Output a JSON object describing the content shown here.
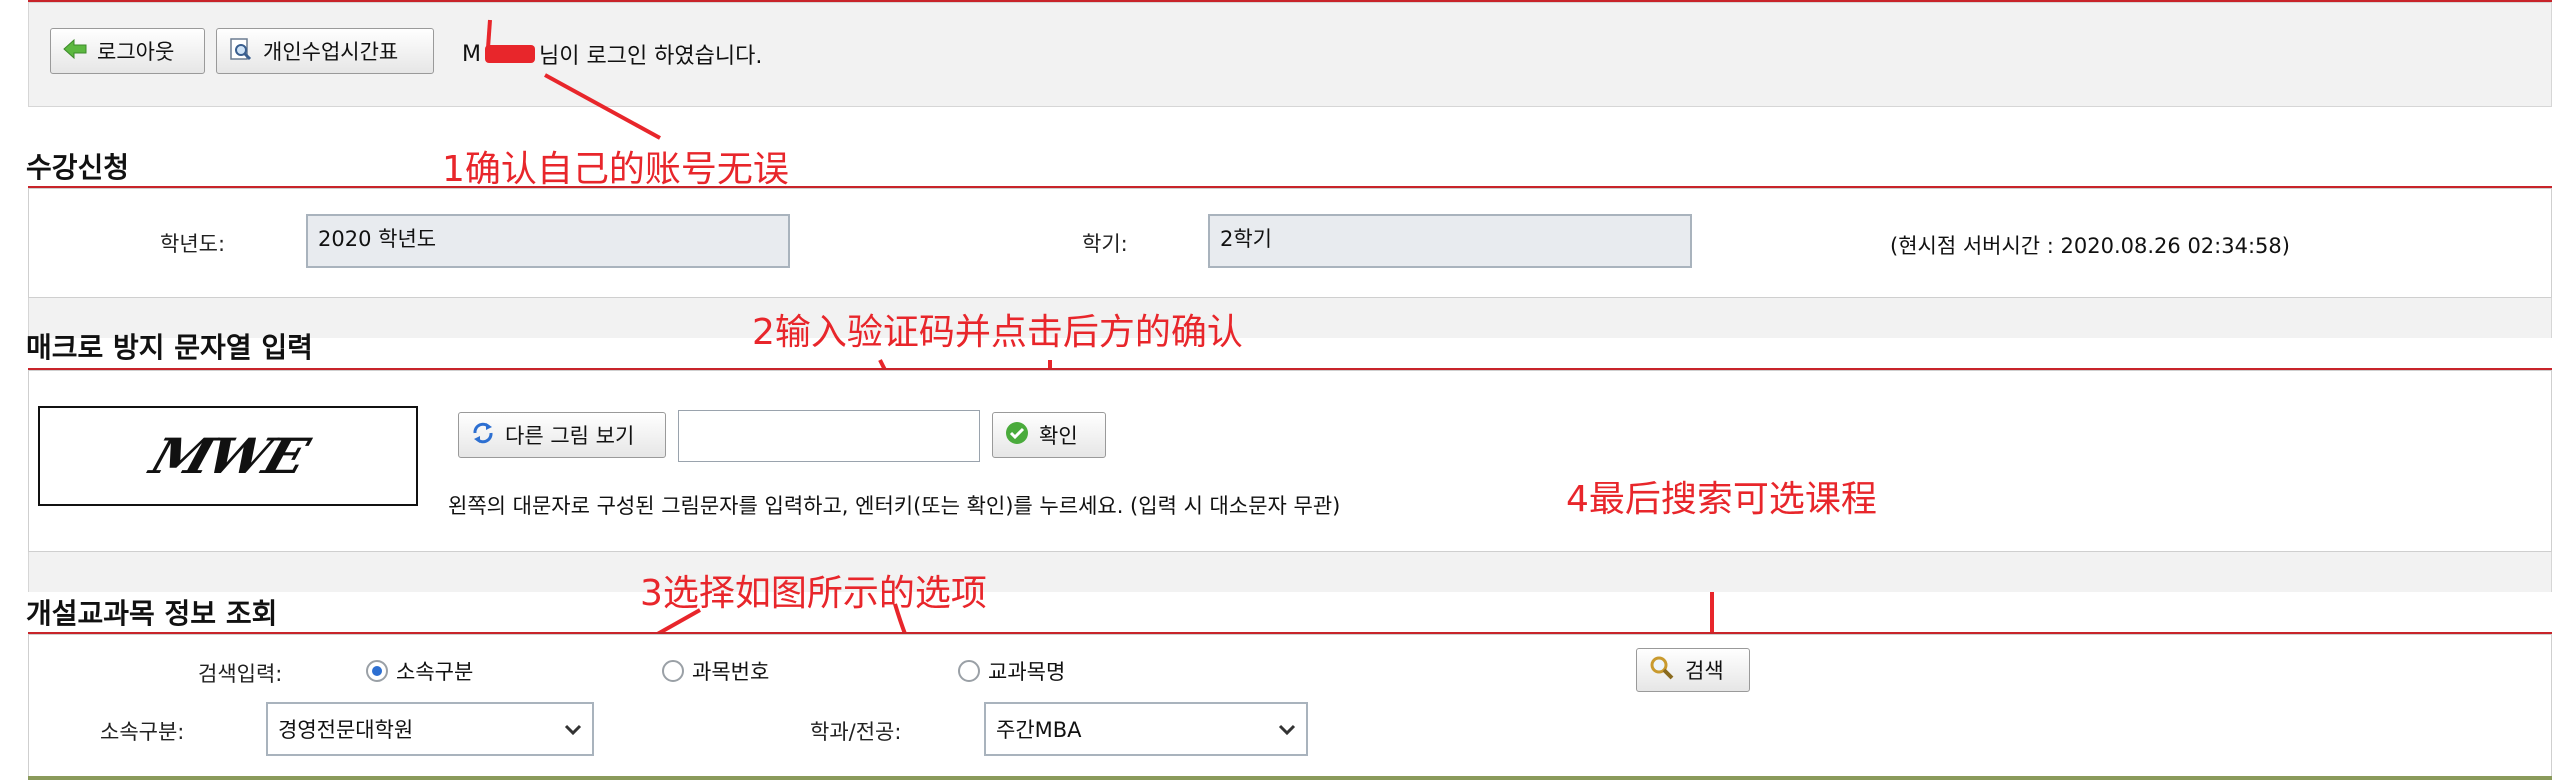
{
  "header": {
    "logout_label": "로그아웃",
    "timetable_label": "개인수업시간표",
    "login_user": "M",
    "login_message": "님이 로그인 하였습니다."
  },
  "registration": {
    "title": "수강신청",
    "year_label": "학년도:",
    "year_value": "2020 학년도",
    "semester_label": "학기:",
    "semester_value": "2학기",
    "server_time": "(현시점 서버시간 :  2020.08.26  02:34:58)"
  },
  "captcha": {
    "title": "매크로 방지 문자열 입력",
    "image_text": "MWE",
    "refresh_label": "다른 그림 보기",
    "input_value": "",
    "confirm_label": "확인",
    "instruction": "왼쪽의 대문자로 구성된 그림문자를 입력하고, 엔터키(또는 확인)를 누르세요. (입력 시 대소문자 무관)"
  },
  "course_search": {
    "title": "개설교과목 정보 조회",
    "search_input_label": "검색입력:",
    "radio_options": [
      {
        "label": "소속구분",
        "selected": true
      },
      {
        "label": "과목번호",
        "selected": false
      },
      {
        "label": "교과목명",
        "selected": false
      }
    ],
    "search_label": "검색",
    "division_label": "소속구분:",
    "division_value": "경영전문대학원",
    "major_label": "학과/전공:",
    "major_value": "주간MBA"
  },
  "annotations": {
    "step1": "1确认自己的账号无误",
    "step2": "2输入验证码并点击后方的确认",
    "step3": "3选择如图所示的选项",
    "step4": "4最后搜索可选课程"
  },
  "colors": {
    "accent_red": "#c8242a",
    "annotation_red": "#e8262b",
    "field_bg": "#e8ebef"
  }
}
